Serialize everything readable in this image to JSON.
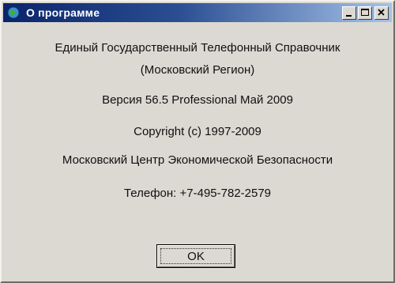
{
  "window": {
    "title": "О программе",
    "icon": "globe-icon",
    "controls": [
      "minimize",
      "maximize",
      "close"
    ]
  },
  "about": {
    "product_line1": "Единый Государственный Телефонный Справочник",
    "product_line2": "(Московский Регион)",
    "version": "Версия 56.5 Professional Май 2009",
    "copyright": "Copyright (c) 1997-2009",
    "company": "Московский Центр Экономической Безопасности",
    "phone": "Телефон: +7-495-782-2579"
  },
  "buttons": {
    "ok_label": "OK"
  },
  "colors": {
    "titlebar_start": "#0a246a",
    "titlebar_end": "#a6c3e8",
    "window_background": "#dcd9d2"
  }
}
